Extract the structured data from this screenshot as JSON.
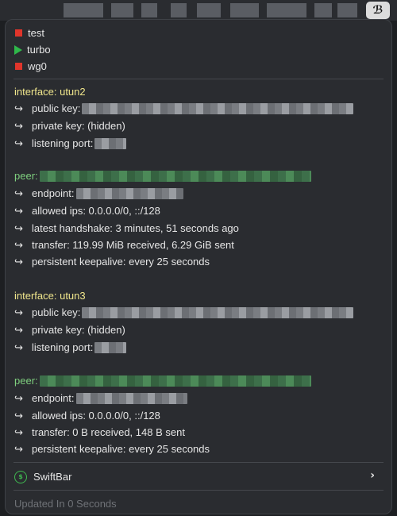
{
  "menubar": {
    "app_icon": "swiftbar-icon"
  },
  "interfaces_list": [
    {
      "label": "test",
      "status": "stopped",
      "color": "#e0352b"
    },
    {
      "label": "turbo",
      "status": "running",
      "color": "#2fb84a"
    },
    {
      "label": "wg0",
      "status": "stopped",
      "color": "#e0352b"
    }
  ],
  "utun2": {
    "heading": "interface: utun2",
    "public_key_label": "public key:",
    "private_key": "private key: (hidden)",
    "listening_port_label": "listening port:"
  },
  "peer1": {
    "heading": "peer:",
    "endpoint_label": "endpoint:",
    "allowed_ips": "allowed ips: 0.0.0.0/0, ::/128",
    "latest_handshake": "latest handshake: 3 minutes, 51 seconds ago",
    "transfer": "transfer: 119.99 MiB received, 6.29 GiB sent",
    "keepalive": "persistent keepalive: every 25 seconds"
  },
  "utun3": {
    "heading": "interface: utun3",
    "public_key_label": "public key:",
    "private_key": "private key: (hidden)",
    "listening_port_label": "listening port:"
  },
  "peer2": {
    "heading": "peer:",
    "endpoint_label": "endpoint:",
    "allowed_ips": "allowed ips: 0.0.0.0/0, ::/128",
    "transfer": "transfer: 0 B received, 148 B sent",
    "keepalive": "persistent keepalive: every 25 seconds"
  },
  "swiftbar": {
    "label": "SwiftBar",
    "icon": "swiftbar-icon"
  },
  "footer": {
    "updated": "Updated In 0 Seconds"
  },
  "arrow_glyph": "↪"
}
